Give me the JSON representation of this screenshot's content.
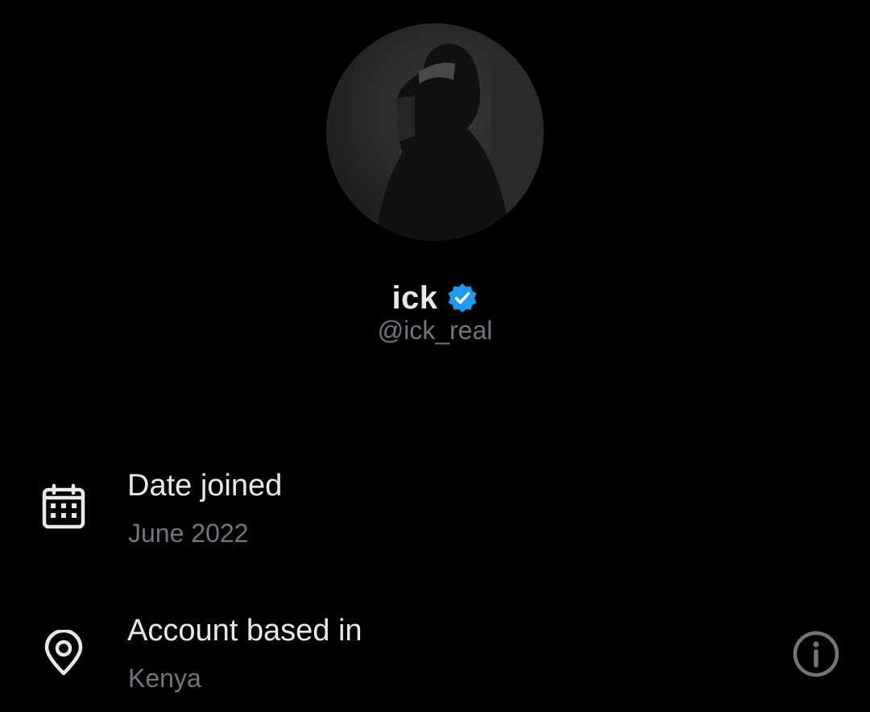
{
  "profile": {
    "avatar_alt": "profile photo",
    "display_name": "ick",
    "handle": "@ick_real",
    "verified": true,
    "verified_color": "#1d9bf0"
  },
  "details": [
    {
      "icon": "calendar-icon",
      "title": "Date joined",
      "value": "June 2022"
    },
    {
      "icon": "location-pin-icon",
      "title": "Account based in",
      "value": "Kenya",
      "action_icon": "info-icon"
    }
  ],
  "colors": {
    "background": "#000000",
    "primary_text": "#e7e9ea",
    "secondary_text": "#71767b"
  }
}
